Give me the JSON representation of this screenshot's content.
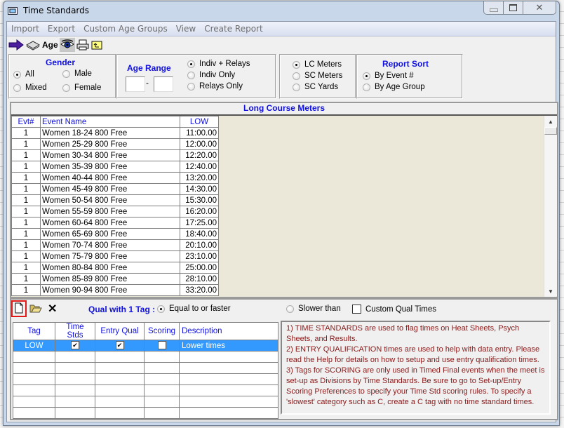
{
  "window": {
    "title": "Time Standards",
    "controls": [
      "minimize",
      "maximize",
      "close"
    ]
  },
  "menu": [
    "Import",
    "Export",
    "Custom Age Groups",
    "View",
    "Create Report"
  ],
  "toolbar": {
    "age_label": "Age",
    "icons": [
      "arrow-right-icon",
      "disk-stack-icon",
      "eye-icon",
      "printer-icon",
      "folder-up-icon"
    ]
  },
  "gender": {
    "title": "Gender",
    "options": [
      "All",
      "Male",
      "Mixed",
      "Female"
    ],
    "selected": "All"
  },
  "age_range": {
    "title": "Age Range",
    "from": "",
    "to": "",
    "separator": "-"
  },
  "event_type": {
    "options": [
      "Indiv + Relays",
      "Indiv Only",
      "Relays Only"
    ],
    "selected": "Indiv + Relays"
  },
  "course": {
    "options": [
      "LC Meters",
      "SC Meters",
      "SC Yards"
    ],
    "selected": "LC Meters"
  },
  "report_sort": {
    "title": "Report Sort",
    "options": [
      "By Event #",
      "By Age Group"
    ],
    "selected": "By Event #"
  },
  "events_panel": {
    "title": "Long Course Meters",
    "columns": [
      "Evt#",
      "Event Name",
      "LOW"
    ],
    "rows": [
      [
        "1",
        "Women 18-24 800 Free",
        "11:00.00"
      ],
      [
        "1",
        "Women 25-29 800 Free",
        "12:00.00"
      ],
      [
        "1",
        "Women 30-34 800 Free",
        "12:20.00"
      ],
      [
        "1",
        "Women 35-39 800 Free",
        "12:40.00"
      ],
      [
        "1",
        "Women 40-44 800 Free",
        "13:20.00"
      ],
      [
        "1",
        "Women 45-49 800 Free",
        "14:30.00"
      ],
      [
        "1",
        "Women 50-54 800 Free",
        "15:30.00"
      ],
      [
        "1",
        "Women 55-59 800 Free",
        "16:20.00"
      ],
      [
        "1",
        "Women 60-64 800 Free",
        "17:25.00"
      ],
      [
        "1",
        "Women 65-69 800 Free",
        "18:40.00"
      ],
      [
        "1",
        "Women 70-74 800 Free",
        "20:10.00"
      ],
      [
        "1",
        "Women 75-79 800 Free",
        "23:10.00"
      ],
      [
        "1",
        "Women 80-84 800 Free",
        "25:00.00"
      ],
      [
        "1",
        "Women 85-89 800 Free",
        "28:10.00"
      ],
      [
        "1",
        "Women 90-94 800 Free",
        "33:20.00"
      ]
    ]
  },
  "tags_panel": {
    "qual_label": "Qual with 1 Tag :",
    "qual_options": [
      "Equal to or faster",
      "Slower than"
    ],
    "qual_selected": "Equal to or faster",
    "custom_qual_label": "Custom Qual Times",
    "custom_qual_checked": false,
    "columns": [
      "Tag",
      "Time Stds",
      "Entry Qual",
      "Scoring",
      "Description"
    ],
    "rows": [
      {
        "tag": "LOW",
        "time_stds": true,
        "entry_qual": true,
        "scoring": false,
        "description": "Lower times",
        "selected": true
      }
    ],
    "empty_rows": 6
  },
  "help_text": [
    "1)   TIME STANDARDS are used to flag times on Heat Sheets, Psych Sheets, and Results.",
    "2)   ENTRY QUALIFICATION times are used to help with data entry. Please read the Help for details on how to setup and use entry qualification times.",
    "3)   Tags for SCORING are only used in Timed Final events when the meet is set-up as Divisions by Time Standards. Be sure to go to Set-up/Entry Scoring Preferences to specify your Time Std scoring rules. To specify a 'slowest' category such as C, create a C tag with no time standard times."
  ],
  "colors": {
    "accent_blue": "#1010e0",
    "selection": "#3399ff",
    "help_text": "#8b1a1a",
    "highlight": "#e01818"
  }
}
